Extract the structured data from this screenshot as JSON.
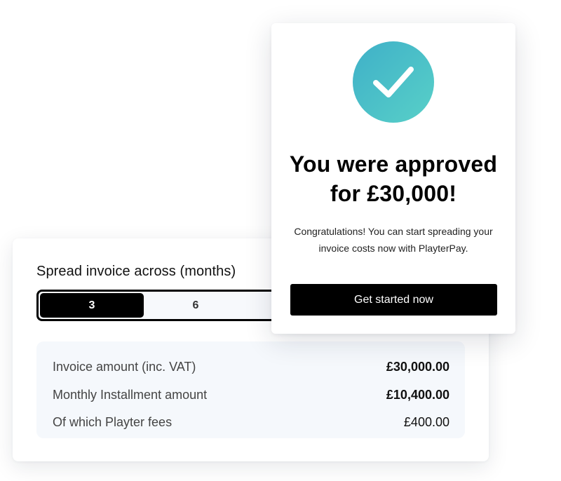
{
  "spread": {
    "title": "Spread invoice across (months)",
    "options": [
      {
        "label": "3",
        "selected": true
      },
      {
        "label": "6",
        "selected": false
      }
    ]
  },
  "summary": {
    "rows": [
      {
        "label": "Invoice amount (inc. VAT)",
        "value": "£30,000.00"
      },
      {
        "label": "Monthly Installment amount",
        "value": "£10,400.00"
      },
      {
        "label": "Of which Playter fees",
        "value": "£400.00"
      }
    ]
  },
  "approval": {
    "icon": "checkmark-icon",
    "title_line1": "You were approved",
    "title_line2": "for £30,000!",
    "body_line1": "Congratulations! You can start spreading your",
    "body_line2": "invoice costs now with PlayterPay.",
    "cta_label": "Get started now",
    "accent_gradient": [
      "#3fb0c8",
      "#58d0c8"
    ]
  }
}
